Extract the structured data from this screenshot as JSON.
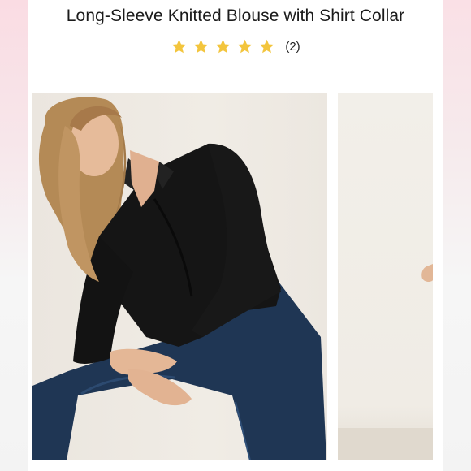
{
  "product": {
    "title": "Long-Sleeve Knitted Blouse with Shirt Collar",
    "rating": {
      "stars": 5,
      "star_color": "#f3c53d",
      "count_text": "(2)"
    }
  },
  "gallery": {
    "images": [
      {
        "name": "product-photo-main",
        "description_icon": "model-photo"
      },
      {
        "name": "product-photo-secondary",
        "description_icon": "model-photo"
      }
    ]
  },
  "colors": {
    "blouse": "#151515",
    "jeans": "#1f3654",
    "backdrop": "#efebe4"
  }
}
